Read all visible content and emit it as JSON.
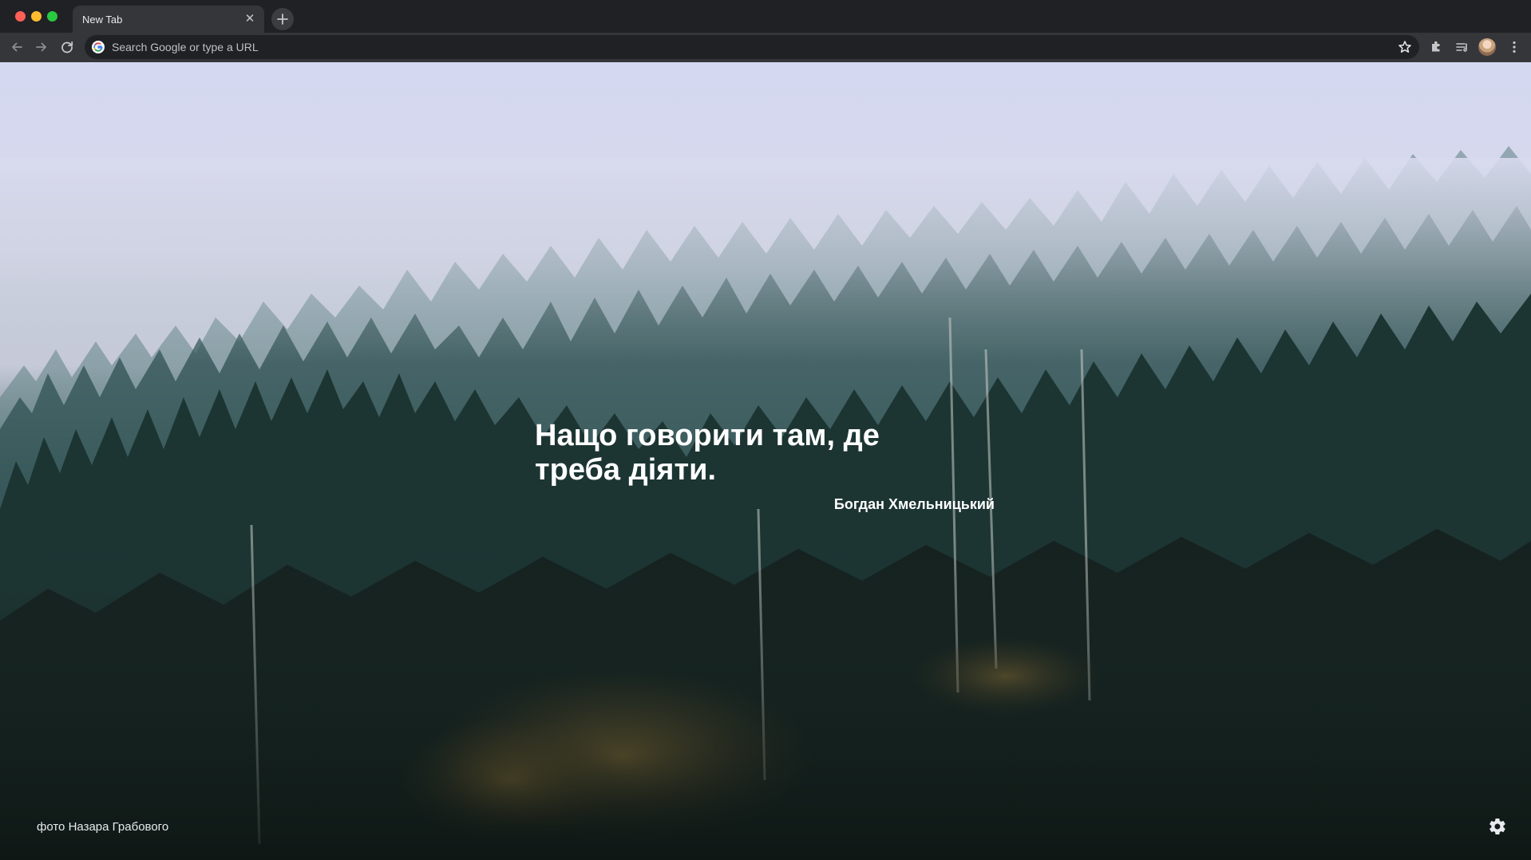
{
  "window": {
    "controls": [
      "close",
      "minimize",
      "zoom"
    ]
  },
  "tabs": [
    {
      "title": "New Tab",
      "active": true
    }
  ],
  "toolbar": {
    "omnibox_placeholder": "Search Google or type a URL",
    "icons": [
      "back-icon",
      "forward-icon",
      "reload-icon",
      "google-icon",
      "star-icon",
      "extensions-icon",
      "reading-list-icon",
      "avatar",
      "menu-icon"
    ]
  },
  "new_tab_page": {
    "quote": "Нащо говорити там, де треба діяти.",
    "author": "Богдан Хмельницький",
    "photo_credit": "фото Назара Грабового",
    "settings_icon": "gear-icon"
  },
  "colors": {
    "frame": "#202124",
    "toolbar": "#35363a",
    "omnibox": "#202124",
    "text": "#ffffff"
  }
}
